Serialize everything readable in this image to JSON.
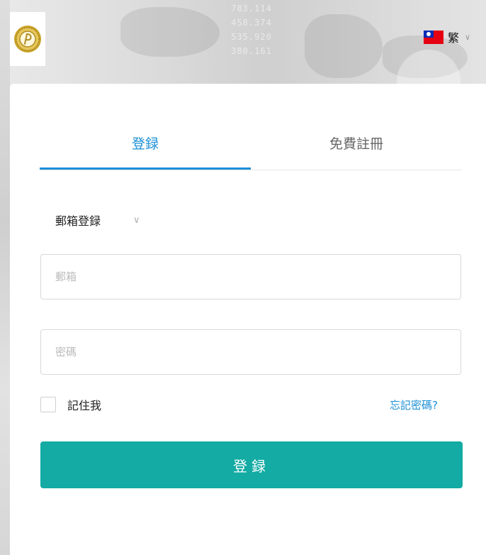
{
  "header": {
    "logo_icon": "gold-seal-logo-icon",
    "language": {
      "flag_icon": "taiwan-flag-icon",
      "label": "繁",
      "chevron_icon": "chevron-down-icon"
    }
  },
  "tabs": [
    {
      "label": "登録",
      "active": true
    },
    {
      "label": "免費註冊",
      "active": false
    }
  ],
  "login_method": {
    "selected": "郵箱登録",
    "chevron_icon": "chevron-down-icon"
  },
  "form": {
    "email_placeholder": "郵箱",
    "password_placeholder": "密碼",
    "remember_label": "記住我",
    "forgot_label": "忘記密碼?",
    "submit_label": "登録"
  },
  "colors": {
    "accent_blue": "#1a8fd6",
    "button_teal": "#13aba4"
  }
}
